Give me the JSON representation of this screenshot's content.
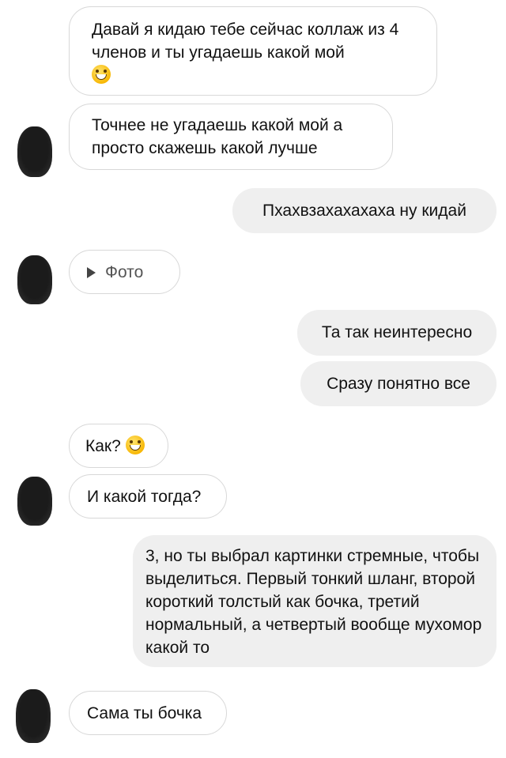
{
  "messages": [
    {
      "text": "Давай я кидаю тебе сейчас коллаж из 4 членов и ты угадаешь какой мой",
      "emoji": "grinning-face"
    },
    {
      "text": "Точнее не угадаешь какой мой а просто скажешь какой лучше"
    },
    {
      "text": "Пхахвзахахахаха ну кидай"
    },
    {
      "text": "Фото"
    },
    {
      "text": "Та так неинтересно"
    },
    {
      "text": "Сразу понятно все"
    },
    {
      "text": "Как?",
      "emoji": "grinning-face"
    },
    {
      "text": "И какой тогда?"
    },
    {
      "text": "3, но ты выбрал картинки стремные, чтобы выделиться. Первый тонкий шланг, второй короткий толстый как бочка, третий нормальный, а четвертый вообще мухомор какой то"
    },
    {
      "text": "Сама ты бочка"
    }
  ],
  "colors": {
    "incoming_bubble": "#ffffff",
    "incoming_border": "#d8d8d8",
    "outgoing_bubble": "#efefef",
    "text": "#111111"
  },
  "icons": {
    "avatar": "obscured-avatar",
    "play": "play-icon",
    "emoji": "grinning-face-emoji"
  }
}
